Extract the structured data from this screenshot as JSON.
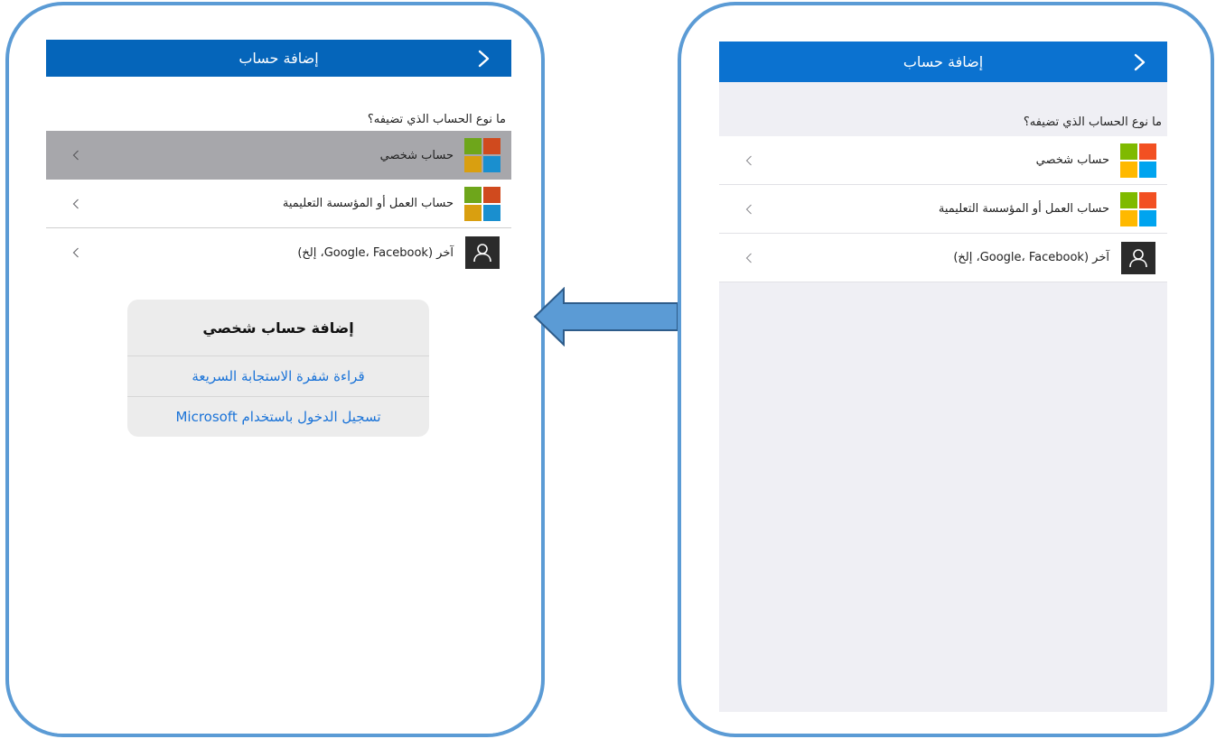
{
  "left_screen": {
    "nav_title": "إضافة حساب",
    "question": "ما نوع الحساب الذي تضيفه؟",
    "rows": [
      {
        "label": "حساب شخصي",
        "icon": "microsoft-logo-icon",
        "selected": true
      },
      {
        "label": "حساب العمل أو المؤسسة التعليمية",
        "icon": "microsoft-logo-icon"
      },
      {
        "label": "آخر (Google، Facebook، إلخ)",
        "icon": "user-icon"
      }
    ],
    "dialog": {
      "title": "إضافة حساب شخصي",
      "buttons": [
        "قراءة شفرة الاستجابة السريعة",
        "تسجيل الدخول باستخدام Microsoft"
      ]
    }
  },
  "right_screen": {
    "nav_title": "إضافة حساب",
    "question": "ما نوع الحساب الذي تضيفه؟",
    "rows": [
      {
        "label": "حساب شخصي",
        "icon": "microsoft-logo-icon"
      },
      {
        "label": "حساب العمل أو المؤسسة التعليمية",
        "icon": "microsoft-logo-icon"
      },
      {
        "label": "آخر (Google، Facebook، إلخ)",
        "icon": "user-icon"
      }
    ]
  },
  "colors": {
    "frame_border": "#5b9bd5",
    "navbar_left": "#0565ba",
    "navbar_right": "#0b72d0",
    "selected_row": "#a7a7ab",
    "dialog_button_text": "#1a73d8",
    "arrow_fill": "#5b9bd5",
    "arrow_stroke": "#2e5c8a"
  }
}
